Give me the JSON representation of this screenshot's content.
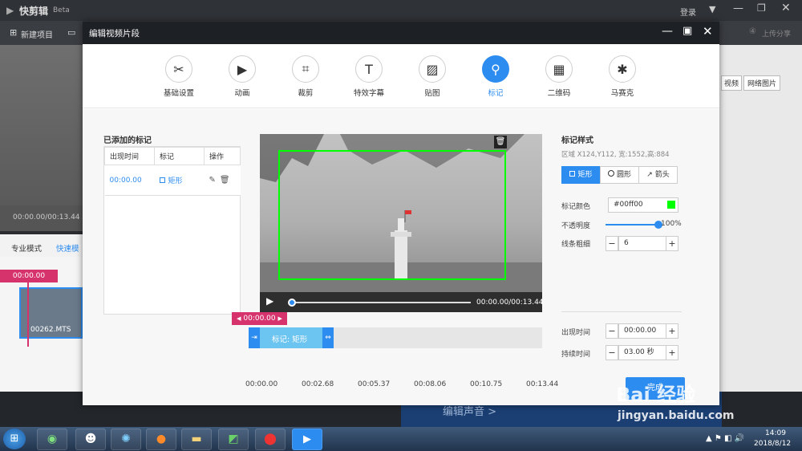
{
  "app": {
    "logo_title": "快剪辑",
    "beta": "Beta",
    "login": "登录",
    "new_project": "新建项目",
    "upload_share": "上传分享",
    "right_btn1": "视频",
    "right_btn2": "网络图片",
    "left_time": "00:00.00/00:13.44",
    "mode_pro": "专业模式",
    "mode_fast": "快速模",
    "timeline_time": "00:00.00",
    "clip_name": "00262.MTS",
    "bottom_label": "编辑声音 >"
  },
  "dialog": {
    "title": "编辑视频片段",
    "tabs": [
      {
        "label": "基础设置",
        "icon": "scissors-icon",
        "glyph": "✂"
      },
      {
        "label": "动画",
        "icon": "play-frame-icon",
        "glyph": "▶"
      },
      {
        "label": "裁剪",
        "icon": "crop-icon",
        "glyph": "⌗"
      },
      {
        "label": "特效字幕",
        "icon": "text-icon",
        "glyph": "T"
      },
      {
        "label": "贴图",
        "icon": "image-icon",
        "glyph": "▨"
      },
      {
        "label": "标记",
        "icon": "pin-icon",
        "glyph": "⚲"
      },
      {
        "label": "二维码",
        "icon": "qrcode-icon",
        "glyph": "▦"
      },
      {
        "label": "马赛克",
        "icon": "mosaic-icon",
        "glyph": "✱"
      }
    ],
    "active_tab": 5
  },
  "markers": {
    "title": "已添加的标记",
    "headers": [
      "出现时间",
      "标记",
      "操作"
    ],
    "rows": [
      {
        "time": "00:00.00",
        "type": "矩形"
      }
    ]
  },
  "preview": {
    "time": "00:00.00/00:13.44",
    "progress": 0
  },
  "timeline": {
    "cursor_time": "00:00.00",
    "clip_label": "标记: 矩形",
    "ticks": [
      "00:00.00",
      "00:02.68",
      "00:05.37",
      "00:08.06",
      "00:10.75",
      "00:13.44"
    ]
  },
  "style_panel": {
    "title": "标记样式",
    "region": "区域 X124,Y112, 宽:1552,高:884",
    "shapes": [
      "矩形",
      "圆形",
      "箭头"
    ],
    "active_shape": 0,
    "color_label": "标记颜色",
    "color_value": "#00ff00",
    "color_hex": "#00ff00",
    "opacity_label": "不透明度",
    "opacity_value": "100%",
    "opacity": 1.0,
    "line_label": "线条粗细",
    "line_value": "6",
    "appear_label": "出现时间",
    "appear_value": "00:00.00",
    "duration_label": "持续时间",
    "duration_value": "03.00 秒",
    "minus": "−",
    "plus": "+"
  },
  "done_button": "完成",
  "watermark": {
    "brand": "Bai 经验",
    "url": "jingyan.baidu.com"
  },
  "taskbar": {
    "time": "14:09",
    "date": "2018/8/12"
  }
}
